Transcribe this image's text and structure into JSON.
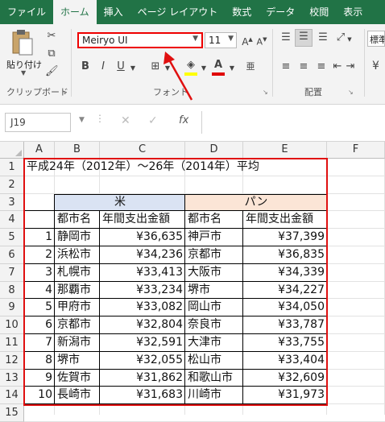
{
  "tabs": [
    "ファイル",
    "ホーム",
    "挿入",
    "ページ レイアウト",
    "数式",
    "データ",
    "校閲",
    "表示"
  ],
  "ribbon": {
    "paste_label": "貼り付け",
    "clipboard_group": "クリップボード",
    "font_group": "フォント",
    "alignment_group": "配置",
    "font_name": "Meiryo UI",
    "font_size": "11",
    "number_format_partial": "標準",
    "currency_symbol": "¥"
  },
  "formula_bar": {
    "name_box": "J19",
    "fx": "fx",
    "value": ""
  },
  "columns": [
    "A",
    "B",
    "C",
    "D",
    "E",
    "F"
  ],
  "rows": [
    "1",
    "2",
    "3",
    "4",
    "5",
    "6",
    "7",
    "8",
    "9",
    "10",
    "11",
    "12",
    "13",
    "14",
    "15"
  ],
  "sheet": {
    "title": "平成24年（2012年）～26年（2014年）平均",
    "rice_header": "米",
    "bread_header": "パン",
    "city_header": "都市名",
    "amount_header": "年間支出金額",
    "records": [
      {
        "rank": "1",
        "rice_city": "静岡市",
        "rice_amount": "¥36,635",
        "bread_city": "神戸市",
        "bread_amount": "¥37,399"
      },
      {
        "rank": "2",
        "rice_city": "浜松市",
        "rice_amount": "¥34,236",
        "bread_city": "京都市",
        "bread_amount": "¥36,835"
      },
      {
        "rank": "3",
        "rice_city": "札幌市",
        "rice_amount": "¥33,413",
        "bread_city": "大阪市",
        "bread_amount": "¥34,339"
      },
      {
        "rank": "4",
        "rice_city": "那覇市",
        "rice_amount": "¥33,234",
        "bread_city": "堺市",
        "bread_amount": "¥34,227"
      },
      {
        "rank": "5",
        "rice_city": "甲府市",
        "rice_amount": "¥33,082",
        "bread_city": "岡山市",
        "bread_amount": "¥34,050"
      },
      {
        "rank": "6",
        "rice_city": "京都市",
        "rice_amount": "¥32,804",
        "bread_city": "奈良市",
        "bread_amount": "¥33,787"
      },
      {
        "rank": "7",
        "rice_city": "新潟市",
        "rice_amount": "¥32,591",
        "bread_city": "大津市",
        "bread_amount": "¥33,755"
      },
      {
        "rank": "8",
        "rice_city": "堺市",
        "rice_amount": "¥32,055",
        "bread_city": "松山市",
        "bread_amount": "¥33,404"
      },
      {
        "rank": "9",
        "rice_city": "佐賀市",
        "rice_amount": "¥31,862",
        "bread_city": "和歌山市",
        "bread_amount": "¥32,609"
      },
      {
        "rank": "10",
        "rice_city": "長崎市",
        "rice_amount": "¥31,683",
        "bread_city": "川崎市",
        "bread_amount": "¥31,973"
      }
    ]
  },
  "colors": {
    "excel_green": "#217346",
    "annotation_red": "#e01010",
    "rice_fill": "#dae3f3",
    "bread_fill": "#fbe5d6"
  }
}
